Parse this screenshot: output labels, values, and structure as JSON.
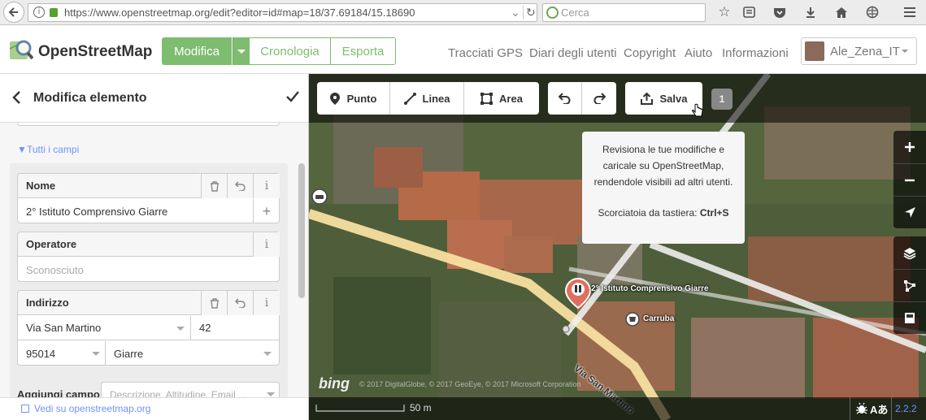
{
  "browser": {
    "url": "https://www.openstreetmap.org/edit?editor=id#map=18/37.69184/15.18690",
    "search_placeholder": "Cerca"
  },
  "header": {
    "brand": "OpenStreetMap",
    "edit_label": "Modifica",
    "history_label": "Cronologia",
    "export_label": "Esporta",
    "nav": [
      "Tracciati GPS",
      "Diari degli utenti",
      "Copyright",
      "Aiuto",
      "Informazioni"
    ],
    "username": "Ale_Zena_IT"
  },
  "sidebar": {
    "title": "Modifica elemento",
    "all_fields_label": "Tutti i campi",
    "fields": {
      "name": {
        "label": "Nome",
        "value": "2° Istituto Comprensivo Giarre"
      },
      "operator": {
        "label": "Operatore",
        "placeholder": "Sconosciuto"
      },
      "address": {
        "label": "Indirizzo",
        "street": "Via San Martino",
        "housenumber": "42",
        "postcode": "95014",
        "city": "Giarre"
      }
    },
    "add_field_label": "Aggiungi campo:",
    "add_field_placeholder": "Descrizione, Altitudine, Email ...",
    "footer_link": "Vedi su openstreetmap.org"
  },
  "map": {
    "toolbar": {
      "point_label": "Punto",
      "line_label": "Linea",
      "area_label": "Area",
      "save_label": "Salva",
      "edit_count": "1"
    },
    "tooltip": {
      "text": "Revisiona le tue modifiche e caricale su OpenStreetMap, rendendole visibili ad altri utenti.",
      "shortcut_label": "Scorciatoia da tastiera:",
      "shortcut_key": "Ctrl+S"
    },
    "labels": {
      "poi_school": "2° Istituto Comprensivo Giarre",
      "poi_shop": "Carruba",
      "street": "Via San Martino"
    },
    "attribution": "© 2017 DigitalGlobe, © 2017 GeoEye, © 2017 Microsoft Corporation",
    "bing_logo": "bing",
    "scale_label": "50 m",
    "version": "2.2.2"
  },
  "colors": {
    "osm_green": "#7ebc6f",
    "pin_red": "#e06e5f"
  }
}
